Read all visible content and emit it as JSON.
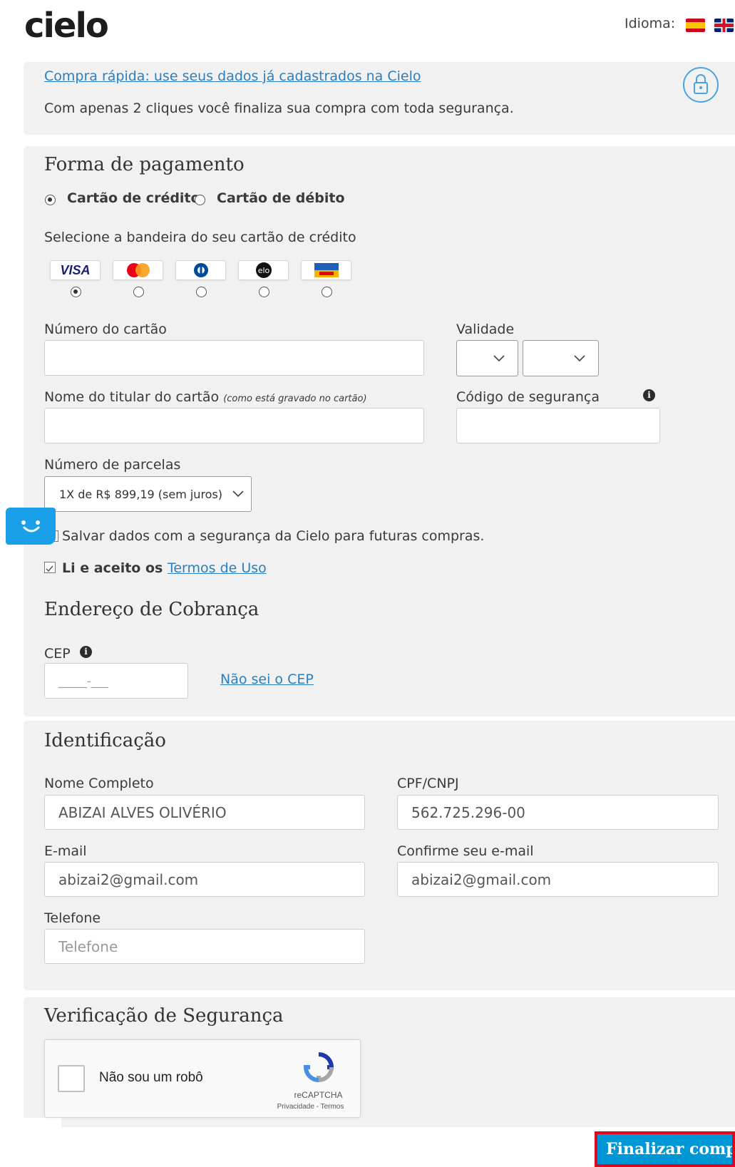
{
  "header": {
    "logo": "cielo",
    "language_label": "Idioma:",
    "flags": [
      "spain-flag-icon",
      "uk-flag-icon"
    ]
  },
  "quick_buy": {
    "link": "Compra rápida: use seus dados já cadastrados na Cielo",
    "description": "Com apenas 2 cliques você finaliza sua compra com toda segurança."
  },
  "payment": {
    "title": "Forma de pagamento",
    "methods": [
      {
        "label": "Cartão de crédito",
        "selected": true
      },
      {
        "label": "Cartão de débito",
        "selected": false
      }
    ],
    "brand_prompt": "Selecione a bandeira do seu cartão de crédito",
    "brands": [
      {
        "name": "VISA",
        "selected": true
      },
      {
        "name": "MasterCard",
        "selected": false
      },
      {
        "name": "Diners",
        "selected": false
      },
      {
        "name": "elo",
        "selected": false
      },
      {
        "name": "Aura",
        "selected": false
      }
    ],
    "card_number_label": "Número do cartão",
    "validity_label": "Validade",
    "holder_label": "Nome do titular do cartão",
    "holder_hint": "(como está gravado no cartão)",
    "security_code_label": "Código de segurança",
    "installments_label": "Número de parcelas",
    "installments_value": "1X de R$ 899,19 (sem juros)",
    "save_data_label": "Salvar dados com a segurança da Cielo para futuras compras.",
    "terms_prefix": "Li e aceito os",
    "terms_link": "Termos de Uso"
  },
  "billing": {
    "title": "Endereço de Cobrança",
    "cep_label": "CEP",
    "cep_value": "_____-___",
    "unknown_cep_link": "Não sei o CEP"
  },
  "identification": {
    "title": "Identificação",
    "full_name_label": "Nome Completo",
    "full_name_value": "ABIZAI ALVES OLIVÉRIO",
    "cpf_label": "CPF/CNPJ",
    "cpf_value": "562.725.296-00",
    "email_label": "E-mail",
    "email_value": "abizai2@gmail.com",
    "confirm_email_label": "Confirme seu e-mail",
    "confirm_email_value": "abizai2@gmail.com",
    "phone_label": "Telefone",
    "phone_placeholder": "Telefone"
  },
  "security": {
    "title": "Verificação de Segurança",
    "captcha_label": "Não sou um robô",
    "captcha_brand": "reCAPTCHA",
    "captcha_links": "Privacidade - Termos"
  },
  "actions": {
    "finalize": "Finalizar compra"
  },
  "colors": {
    "link": "#2a7fc1",
    "panel": "#f1f1f1",
    "button": "#0097d6",
    "highlight": "#e3051b"
  }
}
